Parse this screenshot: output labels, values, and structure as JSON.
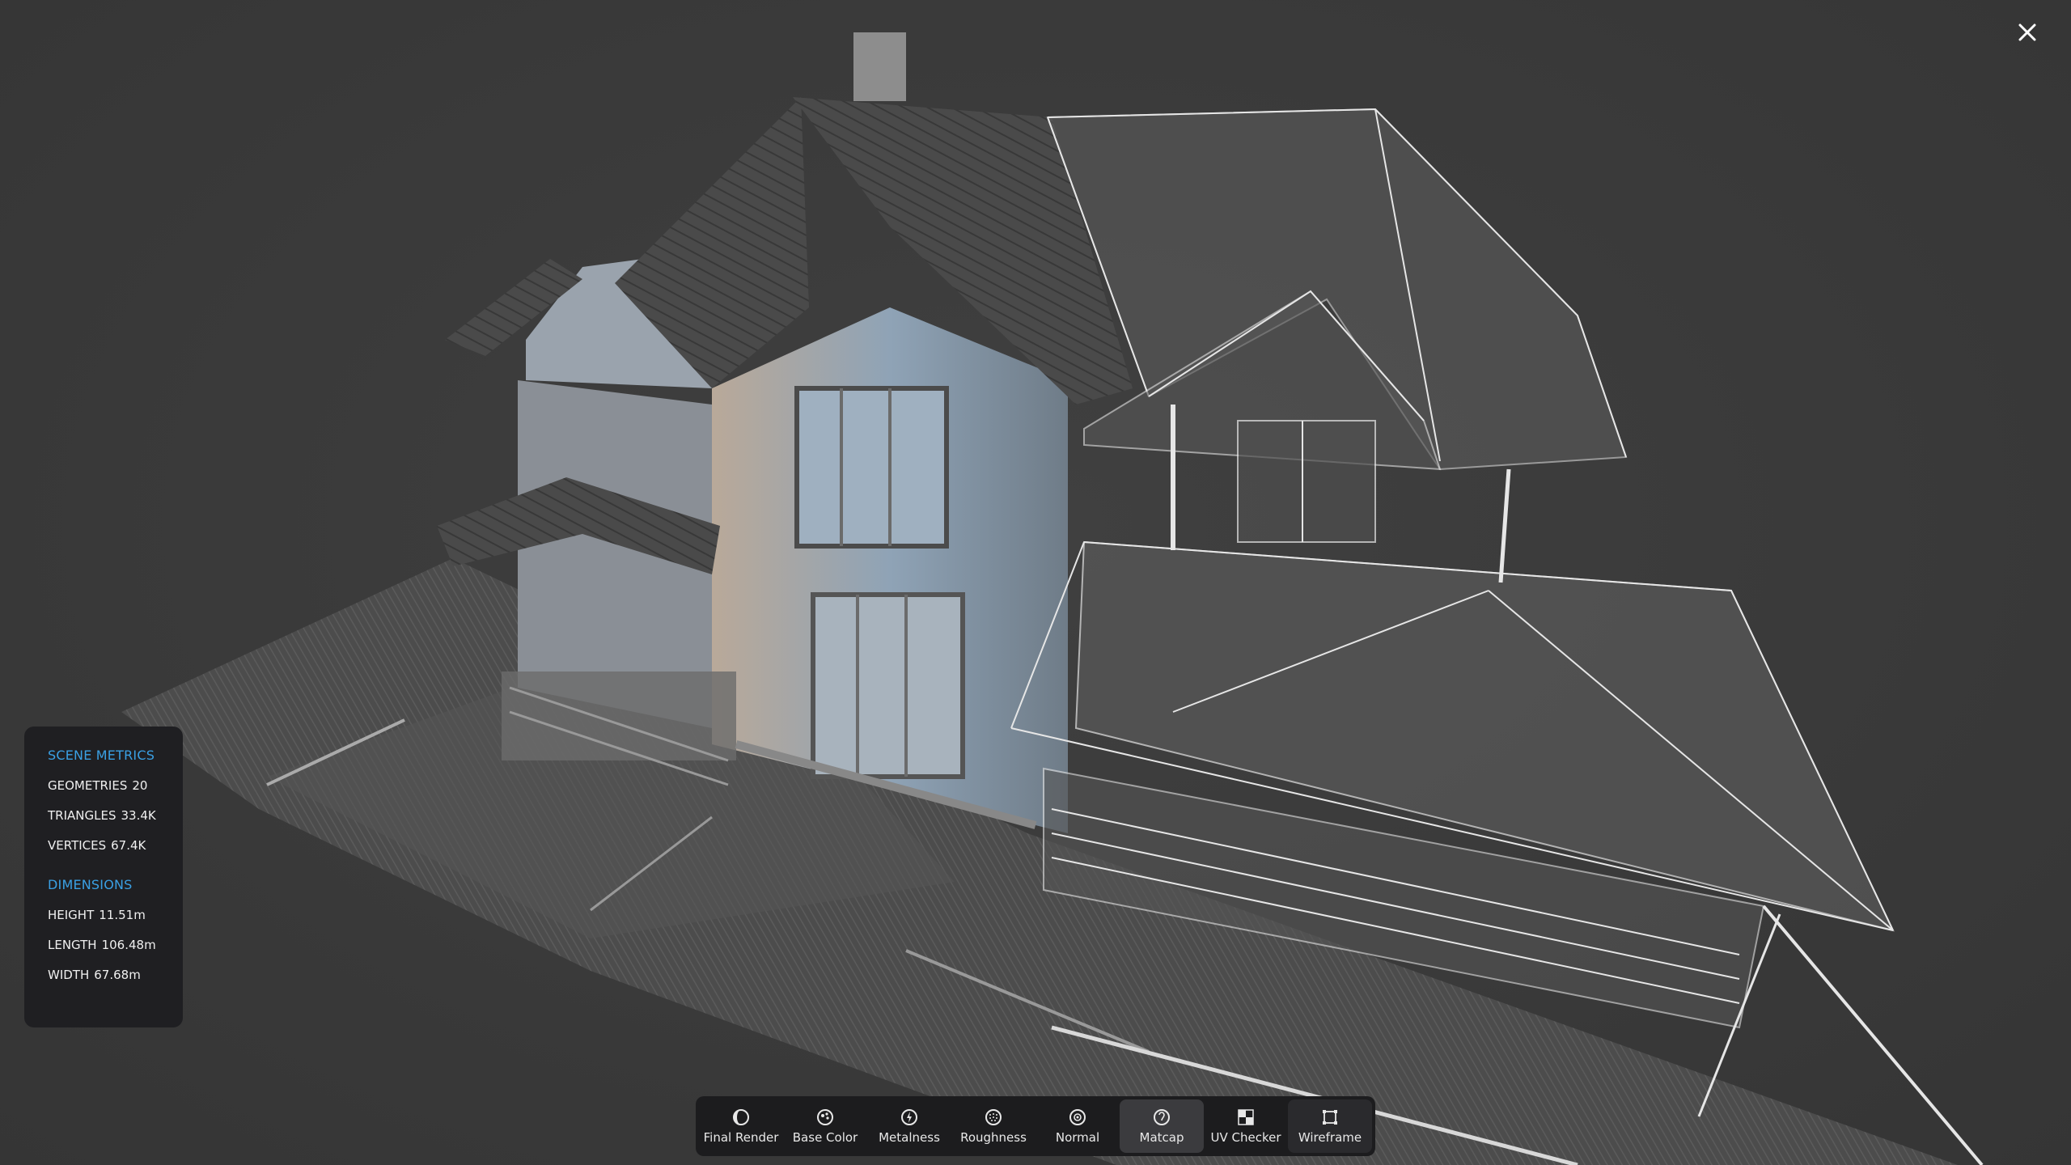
{
  "metrics": {
    "scene_title": "SCENE METRICS",
    "geometries_label": "GEOMETRIES",
    "geometries_value": "20",
    "triangles_label": "TRIANGLES",
    "triangles_value": "33.4K",
    "vertices_label": "VERTICES",
    "vertices_value": "67.4K",
    "dimensions_title": "DIMENSIONS",
    "height_label": "HEIGHT",
    "height_value": "11.51m",
    "length_label": "LENGTH",
    "length_value": "106.48m",
    "width_label": "WIDTH",
    "width_value": "67.68m"
  },
  "toolbar": {
    "items": [
      {
        "label": "Final Render",
        "icon": "final-render-icon"
      },
      {
        "label": "Base Color",
        "icon": "base-color-icon"
      },
      {
        "label": "Metalness",
        "icon": "metalness-icon"
      },
      {
        "label": "Roughness",
        "icon": "roughness-icon"
      },
      {
        "label": "Normal",
        "icon": "normal-icon"
      },
      {
        "label": "Matcap",
        "icon": "matcap-icon"
      },
      {
        "label": "UV Checker",
        "icon": "uv-checker-icon"
      },
      {
        "label": "Wireframe",
        "icon": "wireframe-icon"
      }
    ],
    "active": "Matcap",
    "selected": "Wireframe"
  },
  "colors": {
    "accent": "#3aa0e4",
    "background": "#3a3a3a",
    "panel": "#1f1f22"
  }
}
